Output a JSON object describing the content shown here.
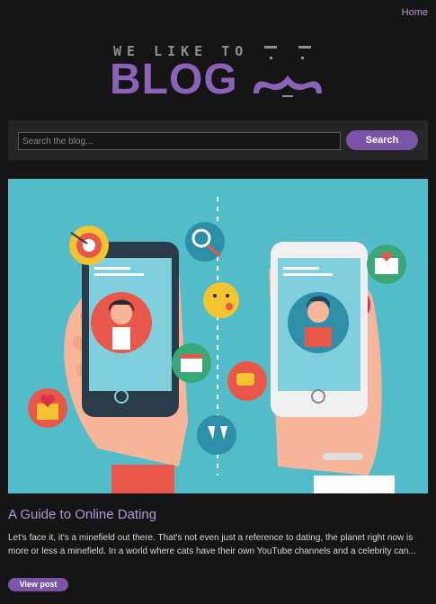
{
  "nav": {
    "home_label": "Home"
  },
  "logo": {
    "tagline": "WE LIKE TO",
    "wordmark": "BLOG"
  },
  "search": {
    "placeholder": "Search the blog...",
    "button_label": "Search"
  },
  "post": {
    "title": "A Guide to Online Dating",
    "excerpt": "Let's face it, it's a minefield out there. That's not even just a reference to dating, the planet right now is more or less a minefield. In a world where cats have their own YouTube channels and a celebrity can...",
    "cta_label": "View post"
  },
  "colors": {
    "page_background": "#151515",
    "accent_purple": "#7a54a8",
    "link_lavender": "#b597d8",
    "hero_teal": "#53bcc9"
  }
}
